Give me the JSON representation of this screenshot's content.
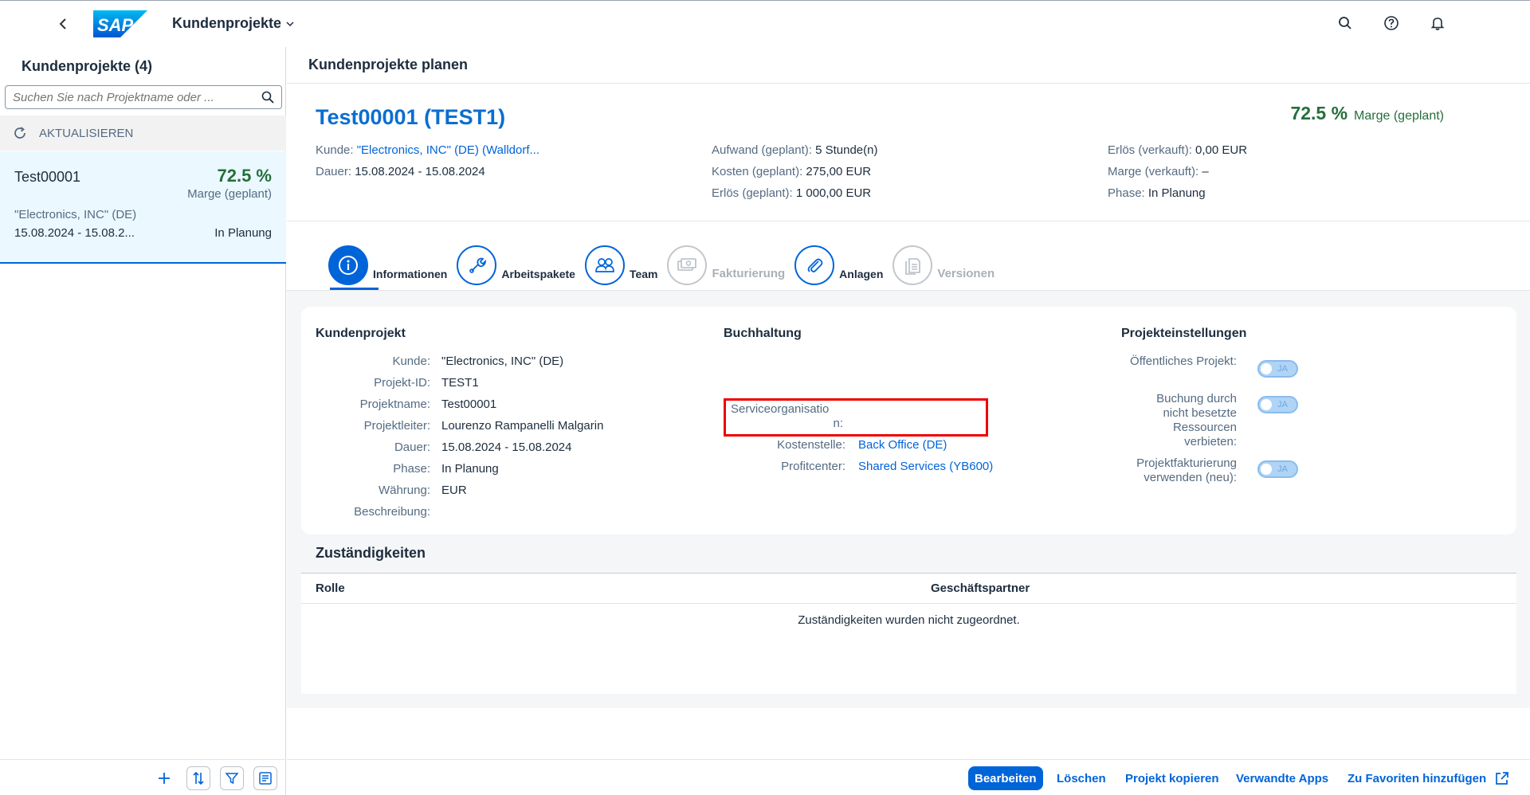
{
  "shell": {
    "app_title": "Kundenprojekte",
    "logo_text": "SAP",
    "icons": [
      "back-icon",
      "search-icon",
      "help-icon",
      "notification-bell-icon"
    ]
  },
  "master": {
    "title": "Kundenprojekte (4)",
    "search_placeholder": "Suchen Sie nach Projektname oder ...",
    "refresh_label": "AKTUALISIEREN",
    "items": [
      {
        "name": "Test00001",
        "margin": "72.5 %",
        "margin_label": "Marge (geplant)",
        "customer": "\"Electronics, INC\" (DE)",
        "dates": "15.08.2024 - 15.08.2...",
        "status": "In Planung"
      }
    ]
  },
  "detail": {
    "bar_title": "Kundenprojekte planen",
    "object_title": "Test00001 (TEST1)",
    "kpi_value": "72.5 %",
    "kpi_label": "Marge (geplant)",
    "header_col1": {
      "kunde_label": "Kunde:",
      "kunde_value": "\"Electronics, INC\" (DE) (Walldorf...",
      "dauer_label": "Dauer:",
      "dauer_value": "15.08.2024 - 15.08.2024"
    },
    "header_col2": {
      "aufwand_label": "Aufwand (geplant):",
      "aufwand_value": "5 Stunde(n)",
      "kosten_label": "Kosten (geplant):",
      "kosten_value": "275,00 EUR",
      "erloes_label": "Erlös (geplant):",
      "erloes_value": "1 000,00 EUR"
    },
    "header_col3": {
      "erloes_v_label": "Erlös (verkauft):",
      "erloes_v_value": "0,00 EUR",
      "marge_v_label": "Marge (verkauft):",
      "marge_v_value": "–",
      "phase_label": "Phase:",
      "phase_value": "In Planung"
    },
    "tabs": [
      {
        "label": "Informationen",
        "icon": "info-icon",
        "state": "active"
      },
      {
        "label": "Arbeitspakete",
        "icon": "wrench-icon",
        "state": "enabled"
      },
      {
        "label": "Team",
        "icon": "team-icon",
        "state": "enabled"
      },
      {
        "label": "Fakturierung",
        "icon": "money-bills-icon",
        "state": "disabled"
      },
      {
        "label": "Anlagen",
        "icon": "paperclip-icon",
        "state": "enabled"
      },
      {
        "label": "Versionen",
        "icon": "versions-icon",
        "state": "disabled"
      }
    ],
    "kundenprojekt": {
      "title": "Kundenprojekt",
      "rows": [
        {
          "label": "Kunde:",
          "value": "\"Electronics, INC\" (DE)"
        },
        {
          "label": "Projekt-ID:",
          "value": "TEST1"
        },
        {
          "label": "Projektname:",
          "value": "Test00001"
        },
        {
          "label": "Projektleiter:",
          "value": "Lourenzo Rampanelli Malgarin"
        },
        {
          "label": "Dauer:",
          "value": "15.08.2024 - 15.08.2024"
        },
        {
          "label": "Phase:",
          "value": "In Planung"
        },
        {
          "label": "Währung:",
          "value": "EUR"
        },
        {
          "label": "Beschreibung:",
          "value": ""
        }
      ]
    },
    "buchhaltung": {
      "title": "Buchhaltung",
      "serviceorg_label_1": "Serviceorganisatio",
      "serviceorg_label_2": "n:",
      "kostenstelle_label": "Kostenstelle:",
      "kostenstelle_value": "Back Office (DE)",
      "profitcenter_label": "Profitcenter:",
      "profitcenter_value": "Shared Services (YB600)"
    },
    "projekteinstellungen": {
      "title": "Projekteinstellungen",
      "oeffentlich_label": "Öffentliches Projekt:",
      "buchung_label_1": "Buchung durch",
      "buchung_label_2": "nicht besetzte",
      "buchung_label_3": "Ressourcen",
      "buchung_label_4": "verbieten:",
      "fakt_label_1": "Projektfakturierung",
      "fakt_label_2": "verwenden (neu):",
      "toggle_text": "JA"
    },
    "zustaendigkeiten": {
      "title": "Zuständigkeiten",
      "col_role": "Rolle",
      "col_partner": "Geschäftspartner",
      "empty_text": "Zuständigkeiten wurden nicht zugeordnet."
    },
    "footer": {
      "edit": "Bearbeiten",
      "delete": "Löschen",
      "copy": "Projekt kopieren",
      "related": "Verwandte Apps",
      "favorites": "Zu Favoriten hinzufügen"
    }
  },
  "colors": {
    "brand_blue": "#0064d9",
    "positive_green": "#256f3a",
    "highlight_red": "#e00000"
  }
}
